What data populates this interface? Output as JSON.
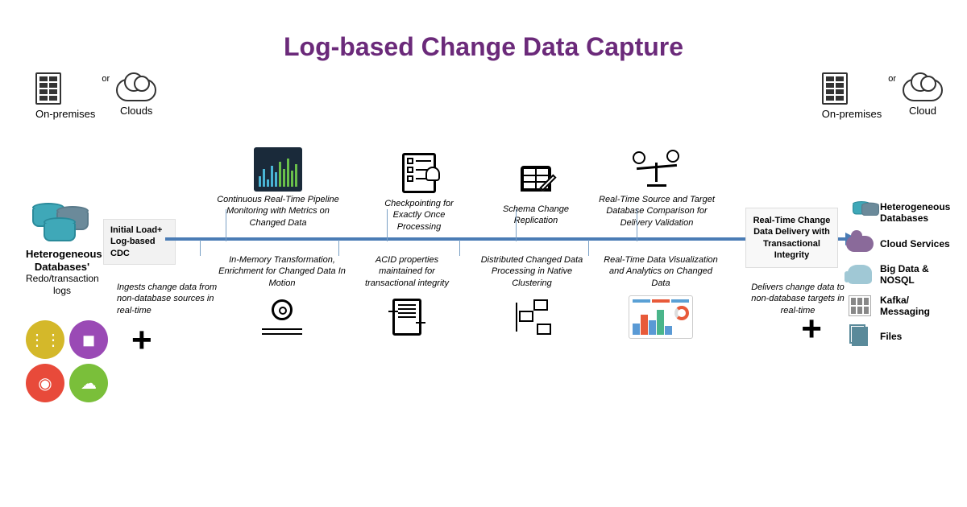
{
  "title": "Log-based Change Data Capture",
  "deploy": {
    "or": "or",
    "onprem": "On-premises",
    "clouds_left": "Clouds",
    "cloud_right": "Cloud"
  },
  "source": {
    "label": "Heterogeneous Databases'",
    "sub": "Redo/transaction logs"
  },
  "load_badge": "Initial Load+ Log-based CDC",
  "delivery_badge": "Real-Time Change Data Delivery with Transactional Integrity",
  "ingest_note": "Ingests change data from non-database sources in real-time",
  "deliver_note": "Delivers change data to non-database targets in real-time",
  "features_top": [
    "Continuous Real-Time Pipeline Monitoring with Metrics on Changed Data",
    "Checkpointing for Exactly Once Processing",
    "Schema Change Replication",
    "Real-Time Source and Target Database Comparison for Delivery Validation"
  ],
  "features_bottom": [
    "In-Memory Transformation, Enrichment for Changed Data In Motion",
    "ACID properties maintained for transactional integrity",
    "Distributed  Changed Data Processing in Native Clustering",
    "Real-Time Data Visualization and Analytics on Changed Data"
  ],
  "targets": [
    "Heterogeneous Databases",
    "Cloud Services",
    "Big Data & NOSQL",
    "Kafka/ Messaging",
    "Files"
  ]
}
